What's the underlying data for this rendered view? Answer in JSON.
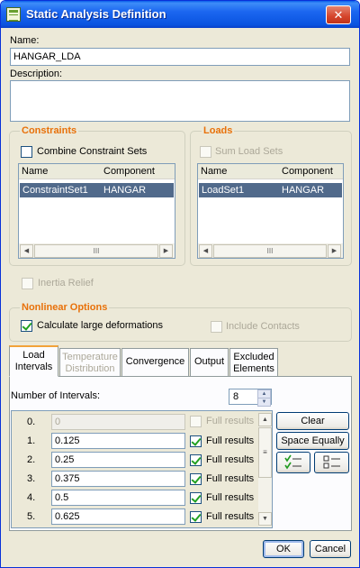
{
  "window": {
    "title": "Static Analysis Definition",
    "close_glyph": "✕"
  },
  "name": {
    "label": "Name:",
    "value": "HANGAR_LDA"
  },
  "description": {
    "label": "Description:",
    "value": ""
  },
  "constraints": {
    "title": "Constraints",
    "combine_label": "Combine Constraint Sets",
    "combine_checked": false,
    "columns": [
      "Name",
      "Component"
    ],
    "rows": [
      {
        "name": "ConstraintSet1",
        "component": "HANGAR"
      }
    ]
  },
  "loads": {
    "title": "Loads",
    "sum_label": "Sum Load Sets",
    "sum_checked": false,
    "columns": [
      "Name",
      "Component"
    ],
    "rows": [
      {
        "name": "LoadSet1",
        "component": "HANGAR"
      }
    ]
  },
  "inertia_relief": {
    "label": "Inertia Relief",
    "checked": false
  },
  "nonlinear": {
    "title": "Nonlinear Options",
    "large_def_label": "Calculate large deformations",
    "large_def_checked": true,
    "contacts_label": "Include Contacts",
    "contacts_checked": false
  },
  "tabs": [
    {
      "line1": "Load",
      "line2": "Intervals"
    },
    {
      "line1": "Temperature",
      "line2": "Distribution"
    },
    {
      "line1": "Convergence",
      "line2": ""
    },
    {
      "line1": "Output",
      "line2": ""
    },
    {
      "line1": "Excluded",
      "line2": "Elements"
    }
  ],
  "intervals": {
    "count_label": "Number of Intervals:",
    "count_value": "8",
    "full_results_label": "Full results",
    "rows": [
      {
        "index": "0.",
        "value": "0",
        "full": false,
        "enabled": false
      },
      {
        "index": "1.",
        "value": "0.125",
        "full": true,
        "enabled": true
      },
      {
        "index": "2.",
        "value": "0.25",
        "full": true,
        "enabled": true
      },
      {
        "index": "3.",
        "value": "0.375",
        "full": true,
        "enabled": true
      },
      {
        "index": "4.",
        "value": "0.5",
        "full": true,
        "enabled": true
      },
      {
        "index": "5.",
        "value": "0.625",
        "full": true,
        "enabled": true
      }
    ],
    "clear_label": "Clear",
    "space_equally_label": "Space Equally"
  },
  "footer": {
    "ok_label": "OK",
    "cancel_label": "Cancel"
  },
  "icons": {
    "scroll_glyph": "III",
    "arrow_left": "◀",
    "arrow_right": "▶",
    "arrow_up": "▲",
    "arrow_down": "▼"
  }
}
